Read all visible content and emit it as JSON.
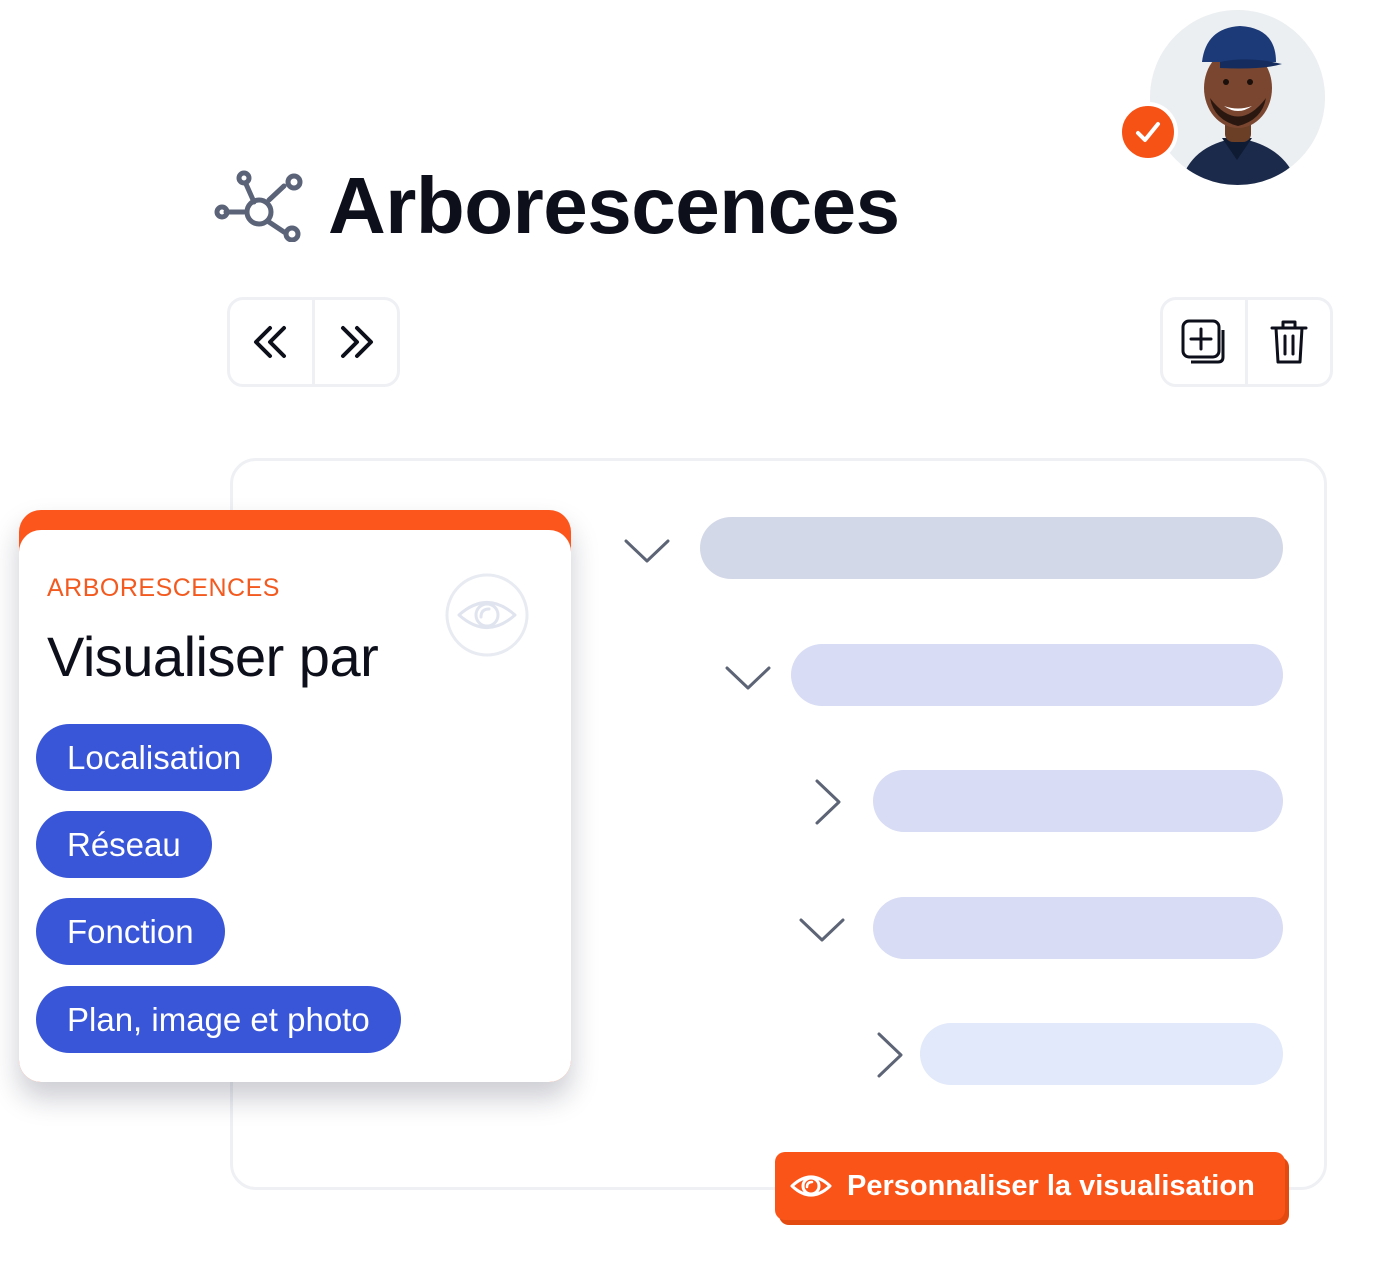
{
  "header": {
    "title": "Arborescences",
    "icon": "hierarchy-network-icon"
  },
  "user": {
    "avatar": "user-avatar",
    "status_icon": "check-icon",
    "status_color": "#f75216"
  },
  "toolbar": {
    "nav": [
      {
        "icon": "chevrons-left-icon",
        "glyph": "«"
      },
      {
        "icon": "chevrons-right-icon",
        "glyph": "»"
      }
    ],
    "actions": [
      {
        "icon": "add-copy-icon"
      },
      {
        "icon": "trash-icon"
      }
    ]
  },
  "tree": {
    "rows": [
      {
        "chevron": "chevron-down-icon",
        "level": 0,
        "color": "#d3d8e8"
      },
      {
        "chevron": "chevron-down-icon",
        "level": 1,
        "color": "#d8dcf4"
      },
      {
        "chevron": "chevron-right-icon",
        "level": 2,
        "color": "#d8dcf4"
      },
      {
        "chevron": "chevron-down-icon",
        "level": 2,
        "color": "#d8dcf4"
      },
      {
        "chevron": "chevron-right-icon",
        "level": 3,
        "color": "#e1e9fa"
      }
    ]
  },
  "card": {
    "label": "ARBORESCENCES",
    "title": "Visualiser par",
    "eye_icon": "eye-icon",
    "accent": "#fc561c",
    "options": [
      "Localisation",
      "Réseau",
      "Fonction",
      "Plan, image et photo"
    ],
    "option_color": "#3a56d8"
  },
  "cta": {
    "label": "Personnaliser la visualisation",
    "icon": "eye-icon",
    "color": "#fa5418"
  }
}
